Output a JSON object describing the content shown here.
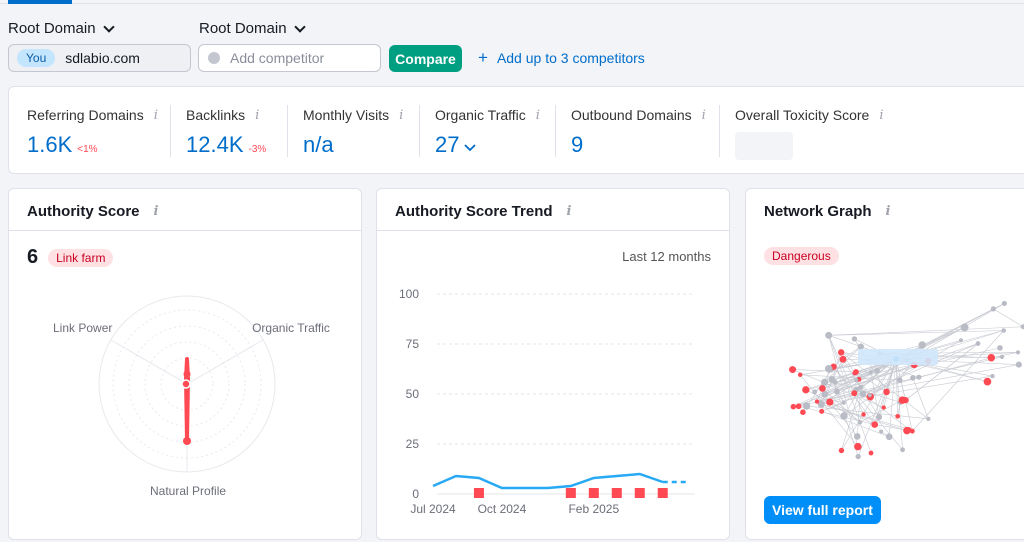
{
  "header": {
    "root_domain_1": "Root Domain",
    "root_domain_2": "Root Domain",
    "you_badge": "You",
    "domain": "sdlabio.com",
    "competitor_placeholder": "Add competitor",
    "compare_label": "Compare",
    "add_competitors_label": "Add up to 3 competitors"
  },
  "metrics": [
    {
      "label": "Referring Domains",
      "value": "1.6K",
      "change": "<1%"
    },
    {
      "label": "Backlinks",
      "value": "12.4K",
      "change": "-3%"
    },
    {
      "label": "Monthly Visits",
      "value": "n/a"
    },
    {
      "label": "Organic Traffic",
      "value": "27"
    },
    {
      "label": "Outbound Domains",
      "value": "9"
    },
    {
      "label": "Overall Toxicity Score"
    }
  ],
  "authority": {
    "title": "Authority Score",
    "score": "6",
    "badge": "Link farm",
    "axes": [
      "Link Power",
      "Organic Traffic",
      "Natural Profile"
    ]
  },
  "trend": {
    "title": "Authority Score Trend",
    "period": "Last 12 months",
    "colors": {
      "line": "#27a9f5",
      "marker": "#ff4953"
    }
  },
  "network": {
    "title": "Network Graph",
    "badge": "Dangerous",
    "view_label": "View full report"
  },
  "chart_data": {
    "type": "line",
    "x": [
      "Jul 2024",
      "Aug 2024",
      "Sep 2024",
      "Oct 2024",
      "Nov 2024",
      "Dec 2024",
      "Jan 2025",
      "Feb 2025",
      "Mar 2025",
      "Apr 2025",
      "May 2025",
      "Jun 2025"
    ],
    "xticks": [
      "Jul 2024",
      "Oct 2024",
      "Feb 2025"
    ],
    "series": [
      {
        "values": [
          4,
          9,
          8,
          3,
          3,
          3,
          4,
          8,
          9,
          10,
          6,
          6
        ]
      }
    ],
    "markers_at": [
      "Sep 2024",
      "Jan 2025",
      "Feb 2025",
      "Mar 2025",
      "Apr 2025",
      "May 2025"
    ],
    "ylim": [
      0,
      100
    ],
    "yticks": [
      0,
      25,
      50,
      75,
      100
    ],
    "xlabel": "",
    "ylabel": ""
  }
}
